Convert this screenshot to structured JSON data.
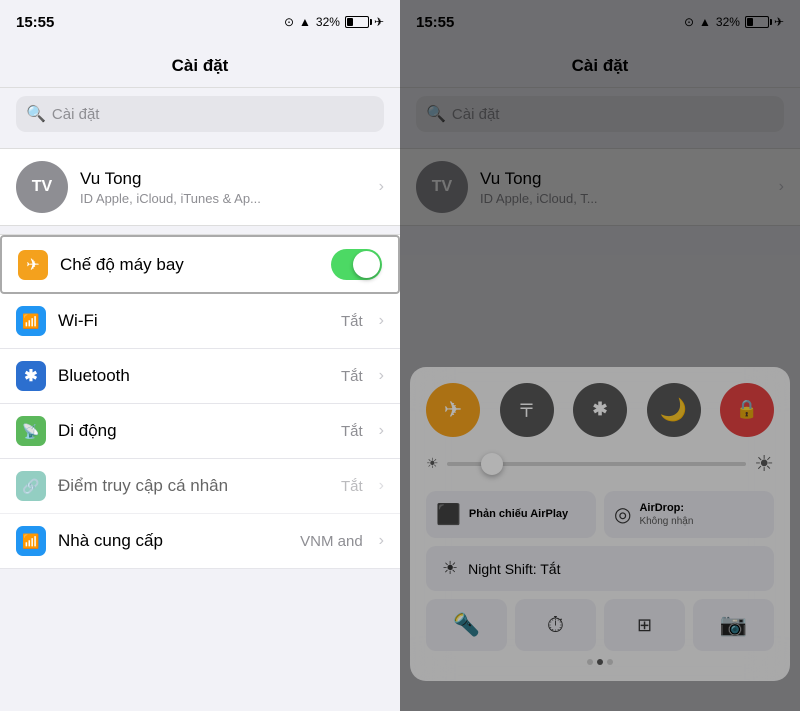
{
  "left": {
    "status": {
      "time": "15:55",
      "battery_pct": "32%",
      "plane_mode": true
    },
    "nav_title": "Cài đặt",
    "search_placeholder": "Cài đặt",
    "profile": {
      "avatar_initials": "TV",
      "name": "Vu Tong",
      "subtitle": "ID Apple, iCloud, iTunes & Ap..."
    },
    "settings": [
      {
        "label": "Chế độ máy bay",
        "icon": "✈",
        "icon_class": "icon-orange",
        "toggle": true,
        "value": "",
        "highlighted": true
      },
      {
        "label": "Wi-Fi",
        "icon": "📶",
        "icon_class": "icon-blue",
        "toggle": false,
        "value": "Tắt"
      },
      {
        "label": "Bluetooth",
        "icon": "✱",
        "icon_class": "icon-blue-bt",
        "toggle": false,
        "value": "Tắt"
      },
      {
        "label": "Di động",
        "icon": "📡",
        "icon_class": "icon-green-cell",
        "toggle": false,
        "value": "Tắt"
      },
      {
        "label": "Điểm truy cập cá nhân",
        "icon": "🔗",
        "icon_class": "icon-teal",
        "toggle": false,
        "value": "Tắt",
        "disabled": true
      },
      {
        "label": "Nhà cung cấp",
        "icon": "📶",
        "icon_class": "icon-blue",
        "toggle": false,
        "value": "VNM and"
      }
    ]
  },
  "right": {
    "status": {
      "time": "15:55",
      "battery_pct": "32%"
    },
    "nav_title": "Cài đặt",
    "search_placeholder": "Cài đặt",
    "profile": {
      "avatar_initials": "TV",
      "name": "Vu Tong",
      "subtitle": "ID Apple, iCloud, T..."
    },
    "control_center": {
      "buttons": [
        {
          "id": "airplane",
          "icon": "✈",
          "class": "cc-btn-airplane",
          "label": "Chế độ máy bay"
        },
        {
          "id": "wifi",
          "icon": "📶",
          "class": "cc-btn-wifi",
          "label": "Wi-Fi"
        },
        {
          "id": "bluetooth",
          "icon": "✱",
          "class": "cc-btn-bt",
          "label": "Bluetooth"
        },
        {
          "id": "moon",
          "icon": "🌙",
          "class": "cc-btn-moon",
          "label": "Không làm phiền"
        },
        {
          "id": "lock",
          "icon": "🔒",
          "class": "cc-btn-lock",
          "label": "Khóa xoay"
        }
      ],
      "airplay_label": "Phản chiếu AirPlay",
      "airdrop_label": "AirDrop:",
      "airdrop_value": "Không nhận",
      "night_shift_label": "Night Shift: Tắt",
      "bottom_icons": [
        "🔦",
        "⏱",
        "⊞",
        "📷"
      ],
      "dots": [
        false,
        true,
        false
      ]
    }
  }
}
